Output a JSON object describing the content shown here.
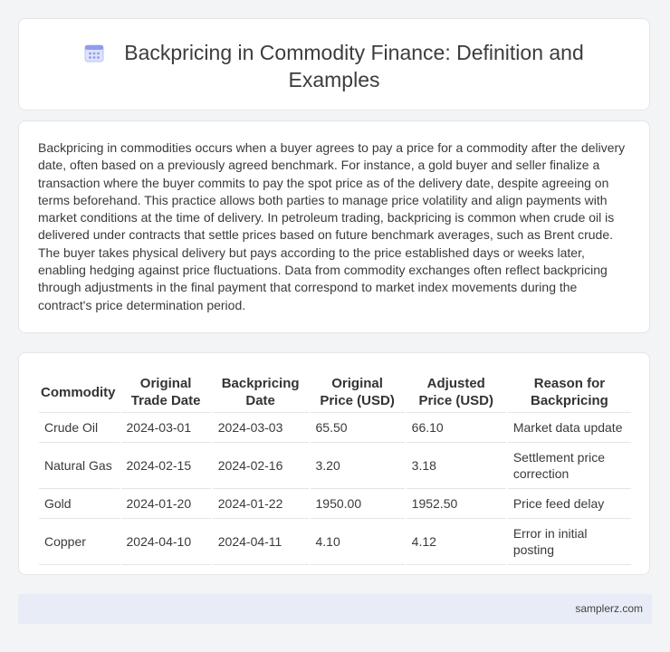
{
  "header": {
    "title": "Backpricing in Commodity Finance: Definition and Examples",
    "icon": "calendar-icon"
  },
  "description": "Backpricing in commodities occurs when a buyer agrees to pay a price for a commodity after the delivery date, often based on a previously agreed benchmark. For instance, a gold buyer and seller finalize a transaction where the buyer commits to pay the spot price as of the delivery date, despite agreeing on terms beforehand. This practice allows both parties to manage price volatility and align payments with market conditions at the time of delivery. In petroleum trading, backpricing is common when crude oil is delivered under contracts that settle prices based on future benchmark averages, such as Brent crude. The buyer takes physical delivery but pays according to the price established days or weeks later, enabling hedging against price fluctuations. Data from commodity exchanges often reflect backpricing through adjustments in the final payment that correspond to market index movements during the contract's price determination period.",
  "table": {
    "headers": [
      "Commodity",
      "Original Trade Date",
      "Backpricing Date",
      "Original Price (USD)",
      "Adjusted Price (USD)",
      "Reason for Backpricing"
    ],
    "rows": [
      [
        "Crude Oil",
        "2024-03-01",
        "2024-03-03",
        "65.50",
        "66.10",
        "Market data update"
      ],
      [
        "Natural Gas",
        "2024-02-15",
        "2024-02-16",
        "3.20",
        "3.18",
        "Settlement price correction"
      ],
      [
        "Gold",
        "2024-01-20",
        "2024-01-22",
        "1950.00",
        "1952.50",
        "Price feed delay"
      ],
      [
        "Copper",
        "2024-04-10",
        "2024-04-11",
        "4.10",
        "4.12",
        "Error in initial posting"
      ]
    ]
  },
  "footer": {
    "site": "samplerz.com"
  }
}
